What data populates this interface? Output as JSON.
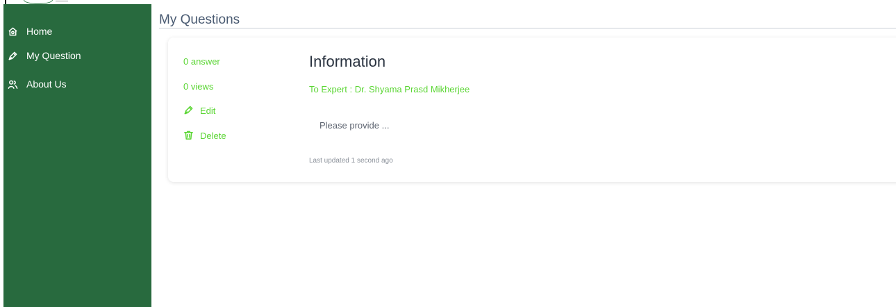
{
  "sidebar": {
    "items": [
      {
        "label": "Home",
        "icon": "home-icon"
      },
      {
        "label": "My Question",
        "icon": "pen-icon"
      },
      {
        "label": "About Us",
        "icon": "users-icon"
      }
    ]
  },
  "main": {
    "page_title": "My Questions"
  },
  "question": {
    "answers": "0 answer",
    "views": "0 views",
    "edit_label": "Edit",
    "delete_label": "Delete",
    "title": "Information",
    "to_expert": "To Expert : Dr. Shyama Prasd Mikherjee",
    "body": "Please provide ...",
    "updated": "Last updated 1 second ago"
  },
  "colors": {
    "sidebar_bg": "#286a3e",
    "accent_green": "#5bd634",
    "title_text": "#4a5b72"
  }
}
